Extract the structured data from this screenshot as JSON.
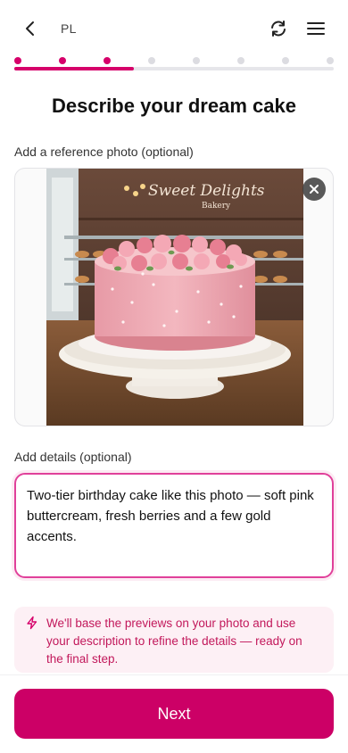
{
  "header": {
    "language": "PL",
    "icons": {
      "back": "chevron-left-icon",
      "refresh": "refresh-icon",
      "menu": "hamburger-menu-icon"
    }
  },
  "progress": {
    "total_steps": 8,
    "completed_steps": 3,
    "fill_fraction": 0.375,
    "accent": "#d6006a"
  },
  "page": {
    "title": "Describe your dream cake"
  },
  "reference_photo": {
    "label": "Add a reference photo (optional)",
    "sign_text": "Sweet Delights",
    "sign_subtext": "Bakery",
    "remove_icon": "close-icon"
  },
  "details": {
    "label": "Add details (optional)",
    "value": "Two-tier birthday cake like this photo — soft pink buttercream, fresh berries and a few gold accents."
  },
  "hint": {
    "icon": "lightning-icon",
    "text": "We'll base the previews on your photo and use your description to refine the details — ready on the final step."
  },
  "footer": {
    "next_label": "Next",
    "button_color": "#cc0066"
  }
}
